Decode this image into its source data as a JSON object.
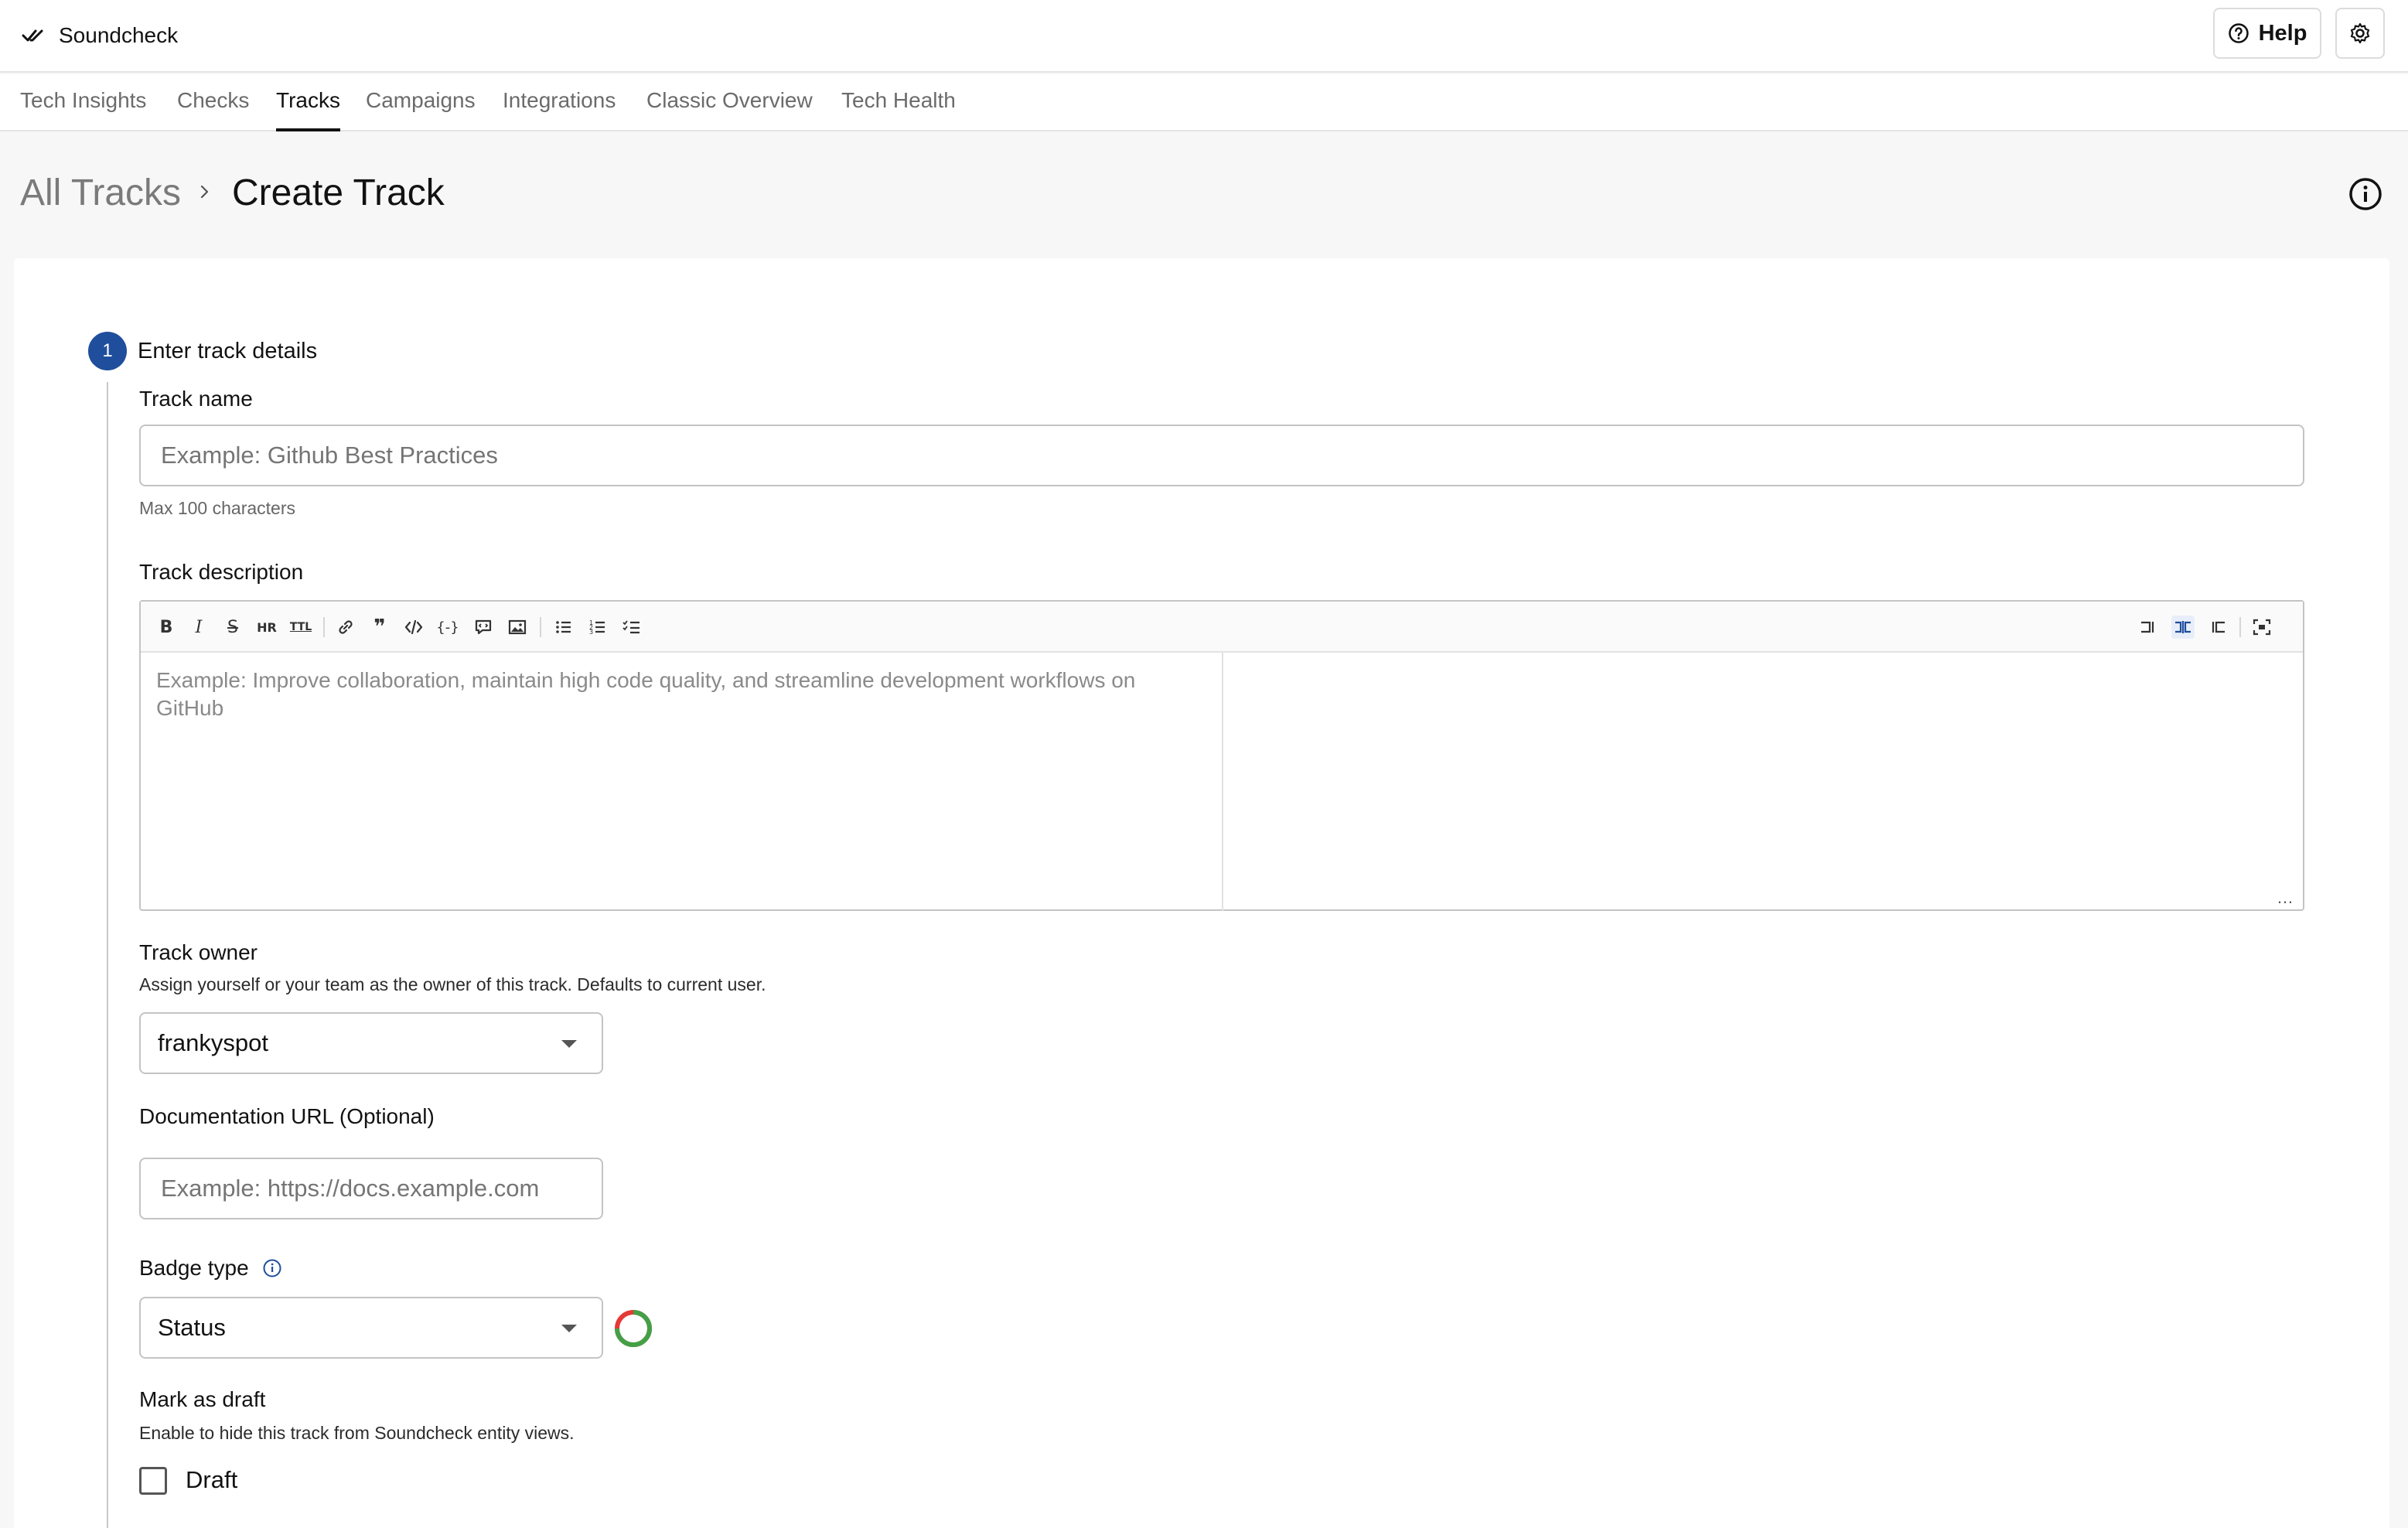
{
  "app": {
    "name": "Soundcheck"
  },
  "header": {
    "help_label": "Help"
  },
  "tabs": [
    {
      "label": "Tech Insights"
    },
    {
      "label": "Checks"
    },
    {
      "label": "Tracks",
      "active": true
    },
    {
      "label": "Campaigns"
    },
    {
      "label": "Integrations"
    },
    {
      "label": "Classic Overview"
    },
    {
      "label": "Tech Health"
    }
  ],
  "breadcrumb": {
    "root": "All Tracks",
    "current": "Create Track"
  },
  "step": {
    "number": "1",
    "title": "Enter track details"
  },
  "form": {
    "track_name": {
      "label": "Track name",
      "placeholder": "Example: Github Best Practices",
      "hint": "Max 100 characters"
    },
    "track_description": {
      "label": "Track description",
      "placeholder": "Example: Improve collaboration, maintain high code quality, and streamline development workflows on GitHub",
      "toolbar": [
        "bold-icon",
        "italic-icon",
        "strikethrough-icon",
        "heading-icon",
        "title-icon",
        "link-icon",
        "quote-icon",
        "code-icon",
        "code-block-icon",
        "comment-icon",
        "image-icon",
        "unordered-list-icon",
        "ordered-list-icon",
        "checked-list-icon",
        "edit-mode-icon",
        "live-mode-icon",
        "preview-mode-icon",
        "fullscreen-icon"
      ]
    },
    "track_owner": {
      "label": "Track owner",
      "hint": "Assign yourself or your team as the owner of this track. Defaults to current user.",
      "value": "frankyspot"
    },
    "documentation_url": {
      "label": "Documentation URL (Optional)",
      "placeholder": "Example: https://docs.example.com"
    },
    "badge_type": {
      "label": "Badge type",
      "value": "Status",
      "ring_colors": [
        "#43a047",
        "#e53935"
      ]
    },
    "draft": {
      "label": "Mark as draft",
      "hint": "Enable to hide this track from Soundcheck entity views.",
      "checkbox_label": "Draft",
      "checked": false
    }
  },
  "colors": {
    "accent": "#1f4e9c",
    "tab_active": "#121212"
  }
}
